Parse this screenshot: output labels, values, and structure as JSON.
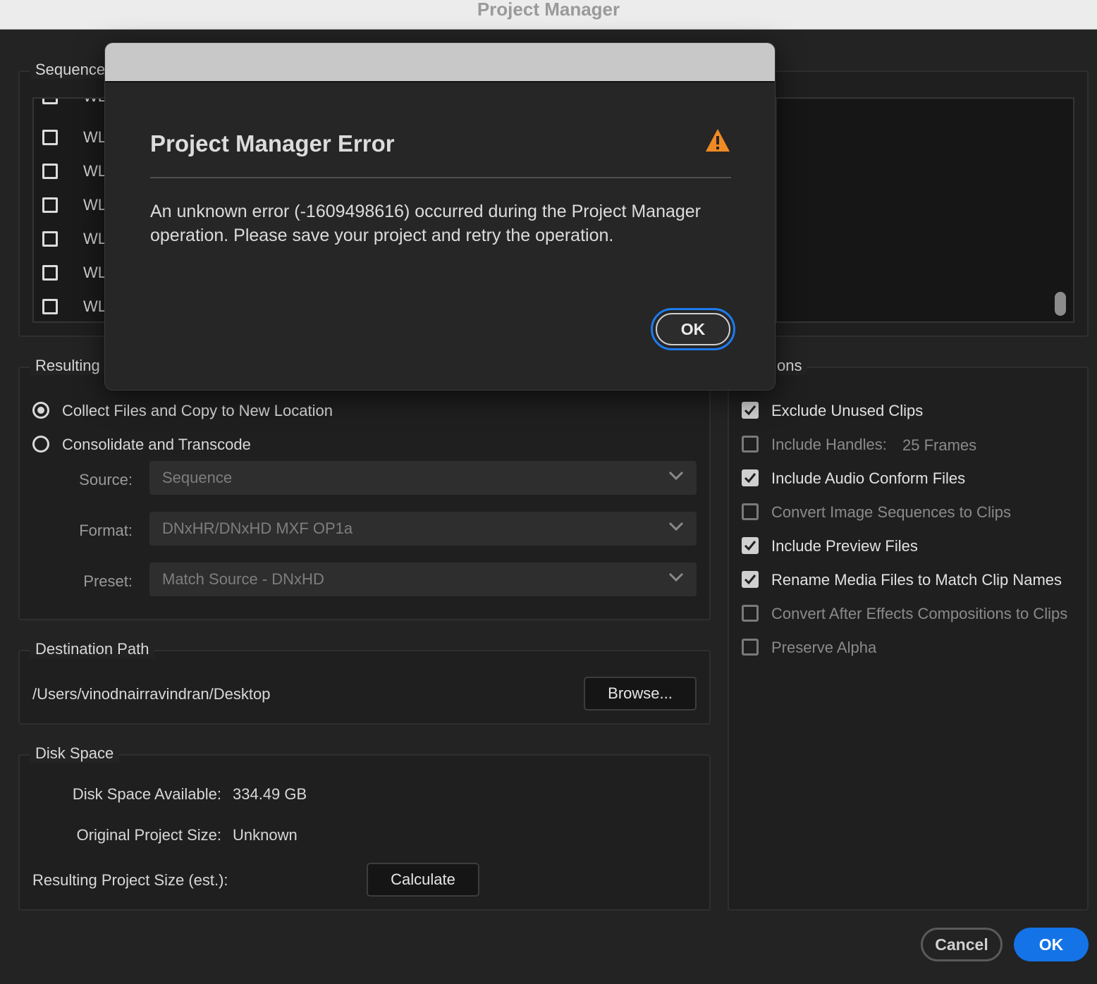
{
  "window": {
    "title": "Project Manager"
  },
  "sequence": {
    "label": "Sequence",
    "items": [
      {
        "name": "WL",
        "checked": false
      },
      {
        "name": "WL",
        "checked": false
      },
      {
        "name": "WL",
        "checked": false
      },
      {
        "name": "WL",
        "checked": false
      },
      {
        "name": "WL",
        "checked": false
      },
      {
        "name": "WL",
        "checked": false
      },
      {
        "name": "WL",
        "checked": false
      }
    ]
  },
  "resulting": {
    "label": "Resulting I",
    "collect_label": "Collect Files and Copy to New Location",
    "consolidate_label": "Consolidate and Transcode",
    "selected": "collect",
    "source_label": "Source:",
    "source_value": "Sequence",
    "format_label": "Format:",
    "format_value": "DNxHR/DNxHD MXF OP1a",
    "preset_label": "Preset:",
    "preset_value": "Match Source - DNxHD"
  },
  "options": {
    "label": "ons",
    "items": [
      {
        "label": "Exclude Unused Clips",
        "checked": true
      },
      {
        "label": "Include Handles:",
        "checked": false,
        "extra": "25 Frames"
      },
      {
        "label": "Include Audio Conform Files",
        "checked": true
      },
      {
        "label": "Convert Image Sequences to Clips",
        "checked": false
      },
      {
        "label": "Include Preview Files",
        "checked": true
      },
      {
        "label": "Rename Media Files to Match Clip Names",
        "checked": true
      },
      {
        "label": "Convert After Effects Compositions to Clips",
        "checked": false
      },
      {
        "label": "Preserve Alpha",
        "checked": false
      }
    ]
  },
  "destination": {
    "label": "Destination Path",
    "path": "/Users/vinodnairravindran/Desktop",
    "browse_label": "Browse..."
  },
  "disk": {
    "label": "Disk Space",
    "available_label": "Disk Space Available:",
    "available_value": "334.49 GB",
    "original_label": "Original Project Size:",
    "original_value": "Unknown",
    "resulting_label": "Resulting Project Size (est.):",
    "calculate_label": "Calculate"
  },
  "footer": {
    "cancel_label": "Cancel",
    "ok_label": "OK"
  },
  "error_dialog": {
    "title": "Project Manager Error",
    "message": "An unknown error (-1609498616) occurred during the Project Manager operation. Please save your project and retry the operation.",
    "ok_label": "OK",
    "icon": "warning-icon",
    "icon_color": "#f08a24"
  },
  "colors": {
    "accent": "#1473e6",
    "warning": "#f08a24"
  }
}
